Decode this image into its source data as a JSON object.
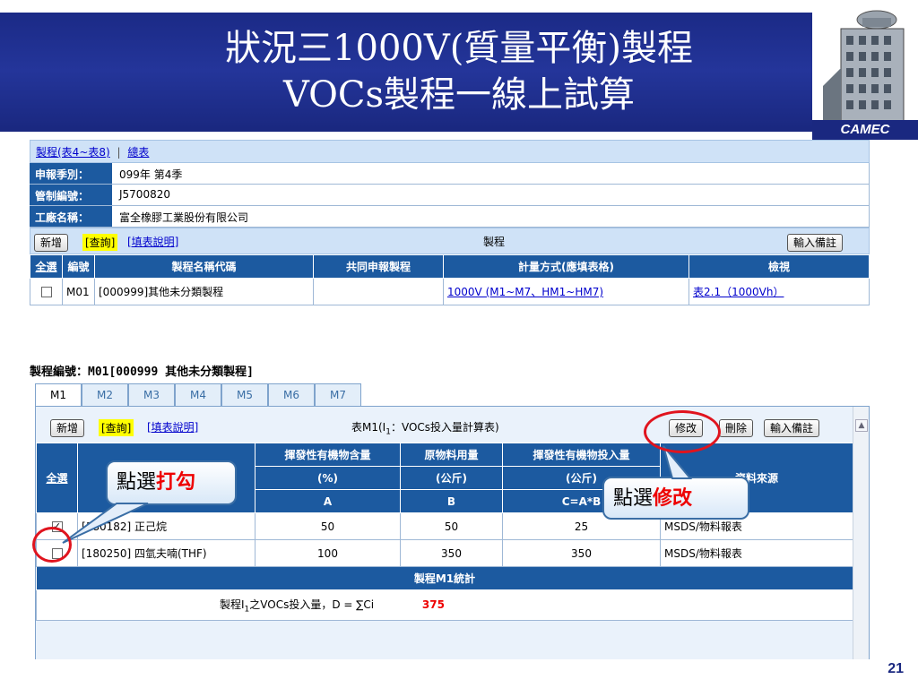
{
  "slide": {
    "title_line1": "狀況三1000V(質量平衡)製程",
    "title_line2": "VOCs製程一線上試算",
    "logo_text": "CAMEC",
    "page_number": "21"
  },
  "breadcrumb": {
    "link1": "製程(表4~表8)",
    "sep": "|",
    "link2": "總表"
  },
  "info": [
    {
      "label": "申報季別：",
      "value": "099年 第4季"
    },
    {
      "label": "管制編號：",
      "value": "J5700820"
    },
    {
      "label": "工廠名稱：",
      "value": "富全橡膠工業股份有限公司"
    }
  ],
  "toolbar1": {
    "add": "新增",
    "query": "[查詢]",
    "help": "[填表說明]",
    "center": "製程",
    "note": "輸入備註"
  },
  "process_table": {
    "headers": [
      "全選",
      "編號",
      "製程名稱代碼",
      "共同申報製程",
      "計量方式(應填表格)",
      "檢視"
    ],
    "row": {
      "id": "M01",
      "name": "[000999]其他未分類製程",
      "shared": "",
      "method": "1000V (M1~M7、HM1~HM7)",
      "view": "表2.1（1000Vh）"
    }
  },
  "process_label": "製程編號：M01[000999 其他未分類製程]",
  "tabs": [
    "M1",
    "M2",
    "M3",
    "M4",
    "M5",
    "M6",
    "M7"
  ],
  "toolbar2": {
    "add": "新增",
    "query": "[查詢]",
    "help": "[填表說明]",
    "center_a": "表M1(I",
    "center_sub": "1",
    "center_b": "：VOCs投入量計算表)",
    "edit": "修改",
    "delete": "刪除",
    "note": "輸入備註"
  },
  "m1_table": {
    "select_all": "全選",
    "h_content": "揮發性有機物含量",
    "h_material": "原物料用量",
    "h_input": "揮發性有機物投入量",
    "h_source": "資料來源",
    "u_content": "(%)",
    "u_material": "(公斤)",
    "u_input": "(公斤)",
    "l_content": "A",
    "l_material": "B",
    "l_input": "C=A*B",
    "rows": [
      {
        "checked": "✓",
        "name": "[180182] 正己烷",
        "a": "50",
        "b": "50",
        "c": "25",
        "source": "MSDS/物料報表"
      },
      {
        "checked": "",
        "name": "[180250] 四氫夫喃(THF)",
        "a": "100",
        "b": "350",
        "c": "350",
        "source": "MSDS/物料報表"
      }
    ],
    "stats_header": "製程M1統計",
    "summary_a": "製程I",
    "summary_sub": "1",
    "summary_b": "之VOCs投入量，D = ∑Ci",
    "summary_value": "375"
  },
  "callouts": {
    "check_prefix": "點選",
    "check_red": "打勾",
    "edit_prefix": "點選",
    "edit_red": "修改"
  },
  "colors": {
    "title_band": "#1b2a86",
    "header_blue": "#1c5aa0",
    "highlight_red": "#e0141e",
    "query_yellow": "#ffff00"
  }
}
